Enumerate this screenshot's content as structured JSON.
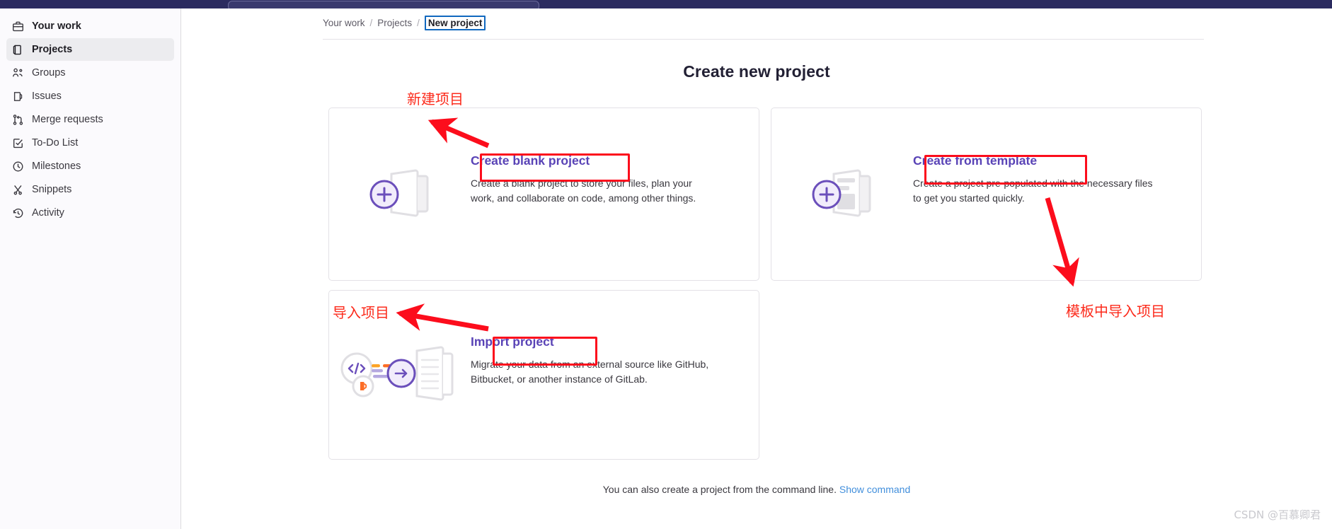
{
  "topbar": {
    "search_placeholder": ""
  },
  "sidebar": {
    "items": [
      {
        "label": "Your work",
        "icon": "briefcase-icon",
        "name": "sidebar-item-your-work",
        "style": "bold"
      },
      {
        "label": "Projects",
        "icon": "project-icon",
        "name": "sidebar-item-projects",
        "style": "active"
      },
      {
        "label": "Groups",
        "icon": "group-icon",
        "name": "sidebar-item-groups",
        "style": ""
      },
      {
        "label": "Issues",
        "icon": "issue-icon",
        "name": "sidebar-item-issues",
        "style": ""
      },
      {
        "label": "Merge requests",
        "icon": "merge-request-icon",
        "name": "sidebar-item-merge-requests",
        "style": ""
      },
      {
        "label": "To-Do List",
        "icon": "todo-checkbox-icon",
        "name": "sidebar-item-todo-list",
        "style": ""
      },
      {
        "label": "Milestones",
        "icon": "clock-icon",
        "name": "sidebar-item-milestones",
        "style": ""
      },
      {
        "label": "Snippets",
        "icon": "scissors-icon",
        "name": "sidebar-item-snippets",
        "style": ""
      },
      {
        "label": "Activity",
        "icon": "history-icon",
        "name": "sidebar-item-activity",
        "style": ""
      }
    ]
  },
  "breadcrumb": {
    "items": [
      {
        "label": "Your work"
      },
      {
        "label": "Projects"
      }
    ],
    "separator": "/",
    "current": "New project"
  },
  "page": {
    "title": "Create new project"
  },
  "cards": [
    {
      "id": "blank",
      "title": "Create blank project",
      "description": "Create a blank project to store your files, plan your work, and collaborate on code, among other things.",
      "icon": "blank-project-icon"
    },
    {
      "id": "template",
      "title": "Create from template",
      "description": "Create a project pre-populated with the necessary files to get you started quickly.",
      "icon": "template-project-icon"
    },
    {
      "id": "import",
      "title": "Import project",
      "description": "Migrate your data from an external source like GitHub, Bitbucket, or another instance of GitLab.",
      "icon": "import-project-icon"
    }
  ],
  "footer": {
    "text": "You can also create a project from the command line.",
    "link_label": "Show command"
  },
  "annotations": {
    "new_project": "新建项目",
    "import_project": "导入项目",
    "template_project": "模板中导入项目",
    "color": "#fc2b1c"
  },
  "watermark": "CSDN @百慕卿君",
  "colors": {
    "accent_purple": "#5943b6",
    "link_blue": "#428fdc",
    "topbar_navy": "#2b2b5f",
    "annotation_red": "#fc0d1c"
  }
}
